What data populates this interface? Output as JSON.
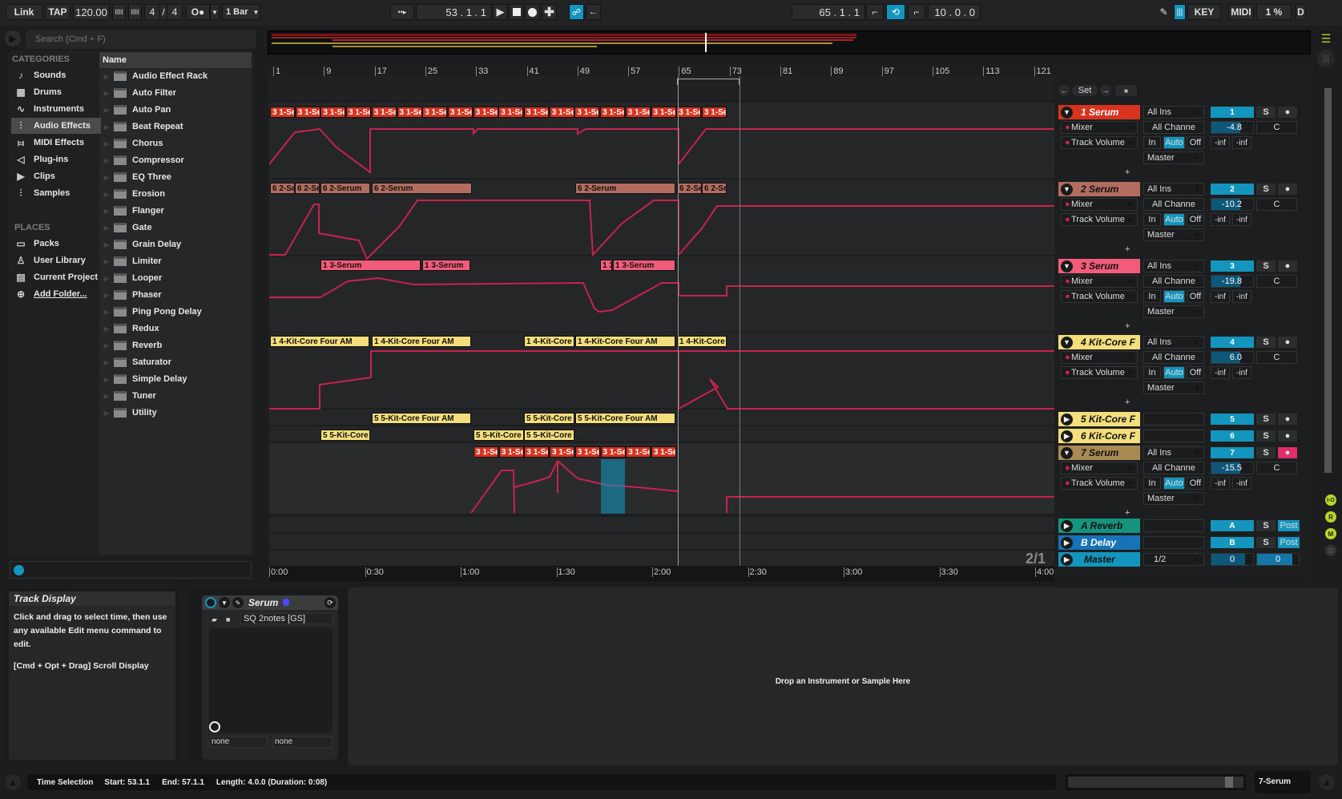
{
  "transport": {
    "link": "Link",
    "tap": "TAP",
    "tempo": "120.00",
    "signature_num": "4",
    "signature_den": "4",
    "metronome": "O●",
    "quantize": "1 Bar",
    "position": "53 .   1 .   1",
    "loop_start": "65 .   1 .   1",
    "loop_length": "10 .   0 .   0",
    "key": "KEY",
    "midi": "MIDI",
    "cpu": "1 %",
    "disk": "D"
  },
  "browser": {
    "search_placeholder": "Search (Cmd + F)",
    "categories_title": "CATEGORIES",
    "categories": [
      {
        "label": "Sounds",
        "icon": "note-icon"
      },
      {
        "label": "Drums",
        "icon": "grid-icon"
      },
      {
        "label": "Instruments",
        "icon": "wave-icon"
      },
      {
        "label": "Audio Effects",
        "icon": "audio-effects-icon",
        "selected": true
      },
      {
        "label": "MIDI Effects",
        "icon": "midi-effects-icon"
      },
      {
        "label": "Plug-ins",
        "icon": "plugin-icon"
      },
      {
        "label": "Clips",
        "icon": "clip-icon"
      },
      {
        "label": "Samples",
        "icon": "sample-icon"
      }
    ],
    "places_title": "PLACES",
    "places": [
      {
        "label": "Packs",
        "icon": "packs-icon"
      },
      {
        "label": "User Library",
        "icon": "user-icon"
      },
      {
        "label": "Current Project",
        "icon": "project-icon"
      },
      {
        "label": "Add Folder...",
        "icon": "add-folder-icon"
      }
    ],
    "column_header": "Name",
    "items": [
      "Audio Effect Rack",
      "Auto Filter",
      "Auto Pan",
      "Beat Repeat",
      "Chorus",
      "Compressor",
      "EQ Three",
      "Erosion",
      "Flanger",
      "Gate",
      "Grain Delay",
      "Limiter",
      "Looper",
      "Phaser",
      "Ping Pong Delay",
      "Redux",
      "Reverb",
      "Saturator",
      "Simple Delay",
      "Tuner",
      "Utility"
    ]
  },
  "arrangement": {
    "bar_markers": [
      "1",
      "9",
      "17",
      "25",
      "33",
      "41",
      "49",
      "57",
      "65",
      "73",
      "81",
      "89",
      "97",
      "105",
      "113",
      "121"
    ],
    "time_markers": [
      "0:00",
      "0:30",
      "1:00",
      "1:30",
      "2:00",
      "2:30",
      "3:00",
      "3:30",
      "4:00"
    ],
    "zoom_ratio": "2/1",
    "locator_set": "Set",
    "clips": {
      "track1": "3 1-Serum",
      "track2": "6 2-Serum",
      "track3": "1 3-Serum",
      "track4": "1 4-Kit-Core Four AM",
      "track5": "5 5-Kit-Core Four AM",
      "track6": "5 5-Kit-Core",
      "track7": "3 1-Serum"
    }
  },
  "tracks": [
    {
      "name": "1 Serum",
      "color": "#d8331f",
      "input": "All Ins",
      "channel": "All Channe",
      "device": "Mixer",
      "param": "Track Volume",
      "output": "Master",
      "number": "1",
      "volume": "-4.8",
      "pan": "C",
      "expanded": true
    },
    {
      "name": "2 Serum",
      "color": "#b26d60",
      "input": "All Ins",
      "channel": "All Channe",
      "device": "Mixer",
      "param": "Track Volume",
      "output": "Master",
      "number": "2",
      "volume": "-10.2",
      "pan": "C",
      "expanded": true
    },
    {
      "name": "3 Serum",
      "color": "#f35b7a",
      "input": "All Ins",
      "channel": "All Channe",
      "device": "Mixer",
      "param": "Track Volume",
      "output": "Master",
      "number": "3",
      "volume": "-19.8",
      "pan": "C",
      "expanded": true
    },
    {
      "name": "4 Kit-Core F",
      "color": "#f4de7b",
      "input": "All Ins",
      "channel": "All Channe",
      "device": "Mixer",
      "param": "Track Volume",
      "output": "Master",
      "number": "4",
      "volume": "6.0",
      "pan": "C",
      "expanded": true
    },
    {
      "name": "5 Kit-Core F",
      "color": "#f4de7b",
      "number": "5",
      "expanded": false
    },
    {
      "name": "6 Kit-Core F",
      "color": "#f4de7b",
      "number": "6",
      "expanded": false
    },
    {
      "name": "7 Serum",
      "color": "#a98a52",
      "input": "All Ins",
      "channel": "All Channe",
      "device": "Mixer",
      "param": "Track Volume",
      "output": "Master",
      "number": "7",
      "volume": "-15.5",
      "pan": "C",
      "expanded": true
    }
  ],
  "monitor": {
    "in": "In",
    "auto": "Auto",
    "off": "Off"
  },
  "meter": {
    "left": "-inf",
    "right": "-inf"
  },
  "solo": "S",
  "returns": [
    {
      "name": "A Reverb",
      "color": "#16937f",
      "number": "A",
      "mode": "Post"
    },
    {
      "name": "B Delay",
      "color": "#1873b6",
      "number": "B",
      "mode": "Post"
    }
  ],
  "master": {
    "name": "Master",
    "color": "#1495bd",
    "cue_out": "1/2",
    "vol": "0",
    "cue": "0"
  },
  "side_buttons": [
    "I-O",
    "R",
    "M",
    "D"
  ],
  "info": {
    "title": "Track Display",
    "body1": "Click and drag to select time, then use any available Edit menu command to edit.",
    "body2": "[Cmd + Opt + Drag] Scroll Display"
  },
  "device": {
    "name": "Serum",
    "preset": "SQ 2notes [GS]",
    "param1": "none",
    "param2": "none",
    "drop_hint": "Drop an Instrument or Sample Here"
  },
  "status": {
    "label": "Time Selection",
    "start": "Start: 53.1.1",
    "end": "End: 57.1.1",
    "length": "Length: 4.0.0  (Duration: 0:08)",
    "selected_track": "7-Serum"
  }
}
